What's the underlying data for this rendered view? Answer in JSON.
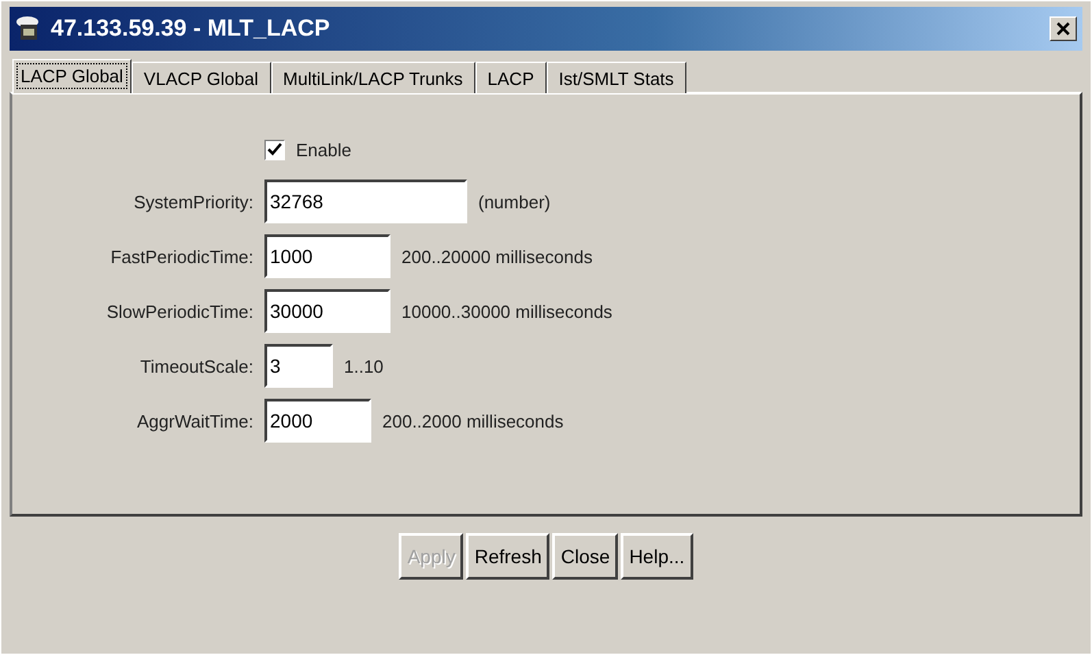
{
  "window": {
    "title": "47.133.59.39 - MLT_LACP"
  },
  "tabs": [
    {
      "label": "LACP Global",
      "selected": true
    },
    {
      "label": "VLACP Global",
      "selected": false
    },
    {
      "label": "MultiLink/LACP Trunks",
      "selected": false
    },
    {
      "label": "LACP",
      "selected": false
    },
    {
      "label": "Ist/SMLT Stats",
      "selected": false
    }
  ],
  "enable": {
    "label": "Enable",
    "checked": true
  },
  "fields": [
    {
      "label": "SystemPriority:",
      "value": "32768",
      "hint": "(number)"
    },
    {
      "label": "FastPeriodicTime:",
      "value": "1000",
      "hint": "200..20000 milliseconds"
    },
    {
      "label": "SlowPeriodicTime:",
      "value": "30000",
      "hint": "10000..30000 milliseconds"
    },
    {
      "label": "TimeoutScale:",
      "value": "3",
      "hint": "1..10"
    },
    {
      "label": "AggrWaitTime:",
      "value": "2000",
      "hint": "200..2000 milliseconds"
    }
  ],
  "buttons": [
    {
      "label": "Apply",
      "disabled": true
    },
    {
      "label": "Refresh",
      "disabled": false
    },
    {
      "label": "Close",
      "disabled": false
    },
    {
      "label": "Help...",
      "disabled": false
    }
  ]
}
